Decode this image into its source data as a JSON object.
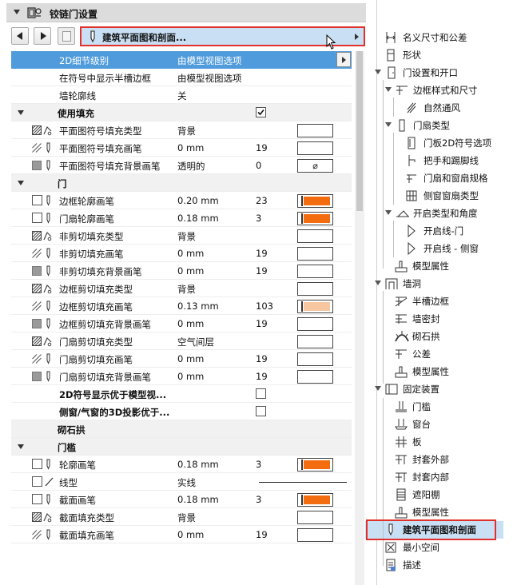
{
  "header": {
    "title": "铰链门设置"
  },
  "nav": {
    "dropdown_label": "建筑平面图和剖面..."
  },
  "colors": {
    "accent": "#4f9bdb",
    "selected": "#c9dff4",
    "highlight_frame": "#e2302b",
    "orange": "#f36c10",
    "light_orange": "#f7c7a2"
  },
  "rows": [
    {
      "label": "2D细节级别",
      "value": "由模型视图选项"
    },
    {
      "label": "在符号中显示半槽边框",
      "value": "由模型视图选项"
    },
    {
      "label": "墙轮廓线",
      "value": "关"
    },
    {
      "label": "使用填充"
    },
    {
      "label": "平面图符号填充类型",
      "value": "背景"
    },
    {
      "label": "平面图符号填充画笔",
      "value": "0 mm",
      "pen": "19"
    },
    {
      "label": "平面图符号填充背景画笔",
      "value": "透明的",
      "pen": "0"
    },
    {
      "label": "门"
    },
    {
      "label": "边框轮廓画笔",
      "value": "0.20 mm",
      "pen": "23"
    },
    {
      "label": "门扇轮廓画笔",
      "value": "0.18 mm",
      "pen": "3"
    },
    {
      "label": "非剪切填充类型",
      "value": "背景"
    },
    {
      "label": "非剪切填充画笔",
      "value": "0 mm",
      "pen": "19"
    },
    {
      "label": "非剪切填充背景画笔",
      "value": "0 mm",
      "pen": "19"
    },
    {
      "label": "边框剪切填充类型",
      "value": "背景"
    },
    {
      "label": "边框剪切填充画笔",
      "value": "0.13 mm",
      "pen": "103"
    },
    {
      "label": "边框剪切填充背景画笔",
      "value": "0 mm",
      "pen": "19"
    },
    {
      "label": "门扇剪切填充类型",
      "value": "空气间层"
    },
    {
      "label": "门扇剪切填充画笔",
      "value": "0 mm",
      "pen": "19"
    },
    {
      "label": "门扇剪切填充背景画笔",
      "value": "0 mm",
      "pen": "19"
    },
    {
      "label": "2D符号显示优于模型视..."
    },
    {
      "label": "侧窗/气窗的3D投影优于..."
    },
    {
      "label": "砌石拱"
    },
    {
      "label": "门槛"
    },
    {
      "label": "轮廓画笔",
      "value": "0.18 mm",
      "pen": "3"
    },
    {
      "label": "线型",
      "value": "实线"
    },
    {
      "label": "截面画笔",
      "value": "0.18 mm",
      "pen": "3"
    },
    {
      "label": "截面填充类型",
      "value": "背景"
    },
    {
      "label": "截面填充画笔",
      "value": "0 mm",
      "pen": "19"
    }
  ],
  "tree": [
    "名义尺寸和公差",
    "形状",
    "门设置和开口",
    "边框样式和尺寸",
    "自然通风",
    "门扇类型",
    "门板2D符号选项",
    "把手和踢脚线",
    "门扇和窗扇规格",
    "侧窗窗扇类型",
    "开启类型和角度",
    "开启线-门",
    "开启线 - 侧窗",
    "模型属性",
    "墙洞",
    "半槽边框",
    "墙密封",
    "砌石拱",
    "公差",
    "模型属性",
    "固定装置",
    "门槛",
    "窗台",
    "板",
    "封套外部",
    "封套内部",
    "遮阳棚",
    "模型属性",
    "建筑平面图和剖面",
    "最小空间",
    "描述"
  ]
}
